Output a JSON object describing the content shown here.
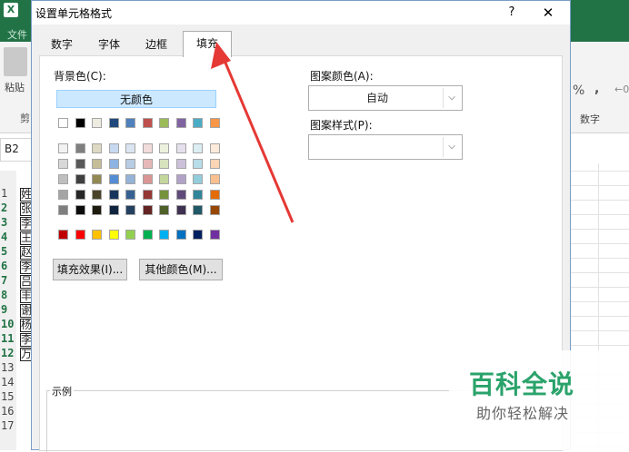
{
  "excel": {
    "app_icon": "X",
    "file_tab": "文件",
    "paste_label": "粘贴",
    "clipboard_label": "剪",
    "name_box": "B2",
    "percent_symbol": "%",
    "comma_symbol": ",",
    "decimal_symbol": "←0",
    "number_group_label": "数字",
    "rows": [
      {
        "num": "1",
        "text": "姓",
        "selected": false
      },
      {
        "num": "2",
        "text": "张",
        "selected": true
      },
      {
        "num": "3",
        "text": "李",
        "selected": true
      },
      {
        "num": "4",
        "text": "王",
        "selected": true
      },
      {
        "num": "5",
        "text": "赵",
        "selected": true
      },
      {
        "num": "6",
        "text": "李",
        "selected": true
      },
      {
        "num": "7",
        "text": "吕",
        "selected": true
      },
      {
        "num": "8",
        "text": "丰",
        "selected": true
      },
      {
        "num": "9",
        "text": "谢",
        "selected": true
      },
      {
        "num": "10",
        "text": "杨",
        "selected": true
      },
      {
        "num": "11",
        "text": "李",
        "selected": true
      },
      {
        "num": "12",
        "text": "万",
        "selected": true
      },
      {
        "num": "13",
        "text": "",
        "selected": false
      },
      {
        "num": "14",
        "text": "",
        "selected": false
      },
      {
        "num": "15",
        "text": "",
        "selected": false
      },
      {
        "num": "16",
        "text": "",
        "selected": false
      },
      {
        "num": "17",
        "text": "",
        "selected": false
      }
    ]
  },
  "dialog": {
    "title": "设置单元格格式",
    "help_glyph": "?",
    "close_glyph": "✕",
    "tabs": [
      "数字",
      "字体",
      "边框",
      "填充"
    ],
    "active_tab": "填充",
    "background_color_label": "背景色(C):",
    "no_color_label": "无颜色",
    "fill_effects_button": "填充效果(I)...",
    "more_colors_button": "其他颜色(M)...",
    "pattern_color_label": "图案颜色(A):",
    "pattern_color_value": "自动",
    "pattern_style_label": "图案样式(P):",
    "pattern_style_value": "",
    "sample_label": "示例",
    "theme_colors_top": [
      "#ffffff",
      "#000000",
      "#eeece1",
      "#1f497d",
      "#4f81bd",
      "#c0504d",
      "#9bbb59",
      "#8064a2",
      "#4bacc6",
      "#f79646"
    ],
    "theme_tints": [
      [
        "#f2f2f2",
        "#7f7f7f",
        "#ddd9c3",
        "#c6d9f0",
        "#dbe5f1",
        "#f2dcdb",
        "#ebf1dd",
        "#e5e0ec",
        "#dbeef3",
        "#fdeada"
      ],
      [
        "#d8d8d8",
        "#595959",
        "#c4bd97",
        "#8db3e2",
        "#b8cce4",
        "#e5b9b7",
        "#d7e3bc",
        "#ccc1d9",
        "#b7dde8",
        "#fbd5b5"
      ],
      [
        "#bfbfbf",
        "#3f3f3f",
        "#938953",
        "#548dd4",
        "#95b3d7",
        "#d99694",
        "#c3d69b",
        "#b2a2c7",
        "#92cddc",
        "#fac08f"
      ],
      [
        "#a5a5a5",
        "#262626",
        "#494429",
        "#17365d",
        "#366092",
        "#953734",
        "#76923c",
        "#5f497a",
        "#31859b",
        "#e36c09"
      ],
      [
        "#7f7f7f",
        "#0c0c0c",
        "#1d1b10",
        "#0f243e",
        "#244061",
        "#632423",
        "#4f6128",
        "#3f3151",
        "#205867",
        "#974806"
      ]
    ],
    "standard_colors": [
      "#c00000",
      "#ff0000",
      "#ffc000",
      "#ffff00",
      "#92d050",
      "#00b050",
      "#00b0f0",
      "#0070c0",
      "#002060",
      "#7030a0"
    ]
  },
  "watermark": {
    "main": "百科全说",
    "sub": "助你轻松解决"
  },
  "colors": {
    "excel_green": "#217346",
    "arrow_red": "#e53935",
    "watermark_green": "#2aa36b"
  }
}
